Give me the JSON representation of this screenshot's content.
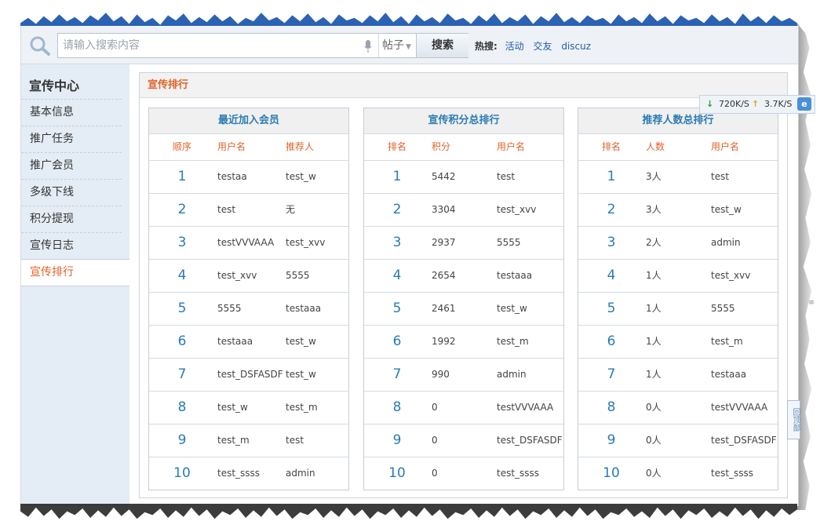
{
  "search": {
    "placeholder": "请输入搜索内容",
    "type_selected": "帖子",
    "button_label": "搜索",
    "hot_label": "热搜:",
    "hot_links": [
      "活动",
      "交友",
      "discuz"
    ]
  },
  "sidebar": {
    "title": "宣传中心",
    "items": [
      {
        "label": "基本信息",
        "active": false
      },
      {
        "label": "推广任务",
        "active": false
      },
      {
        "label": "推广会员",
        "active": false
      },
      {
        "label": "多级下线",
        "active": false
      },
      {
        "label": "积分提现",
        "active": false
      },
      {
        "label": "宣传日志",
        "active": false
      },
      {
        "label": "宣传排行",
        "active": true
      }
    ]
  },
  "panel": {
    "title": "宣传排行"
  },
  "tables": [
    {
      "title": "最近加入会员",
      "columns": [
        "顺序",
        "用户名",
        "推荐人"
      ],
      "rows": [
        [
          "1",
          "testaa",
          "test_w"
        ],
        [
          "2",
          "test",
          "无"
        ],
        [
          "3",
          "testVVVAAA",
          "test_xvv"
        ],
        [
          "4",
          "test_xvv",
          "5555"
        ],
        [
          "5",
          "5555",
          "testaaa"
        ],
        [
          "6",
          "testaaa",
          "test_w"
        ],
        [
          "7",
          "test_DSFASDF",
          "test_w"
        ],
        [
          "8",
          "test_w",
          "test_m"
        ],
        [
          "9",
          "test_m",
          "test"
        ],
        [
          "10",
          "test_ssss",
          "admin"
        ]
      ]
    },
    {
      "title": "宣传积分总排行",
      "columns": [
        "排名",
        "积分",
        "用户名"
      ],
      "rows": [
        [
          "1",
          "5442",
          "test"
        ],
        [
          "2",
          "3304",
          "test_xvv"
        ],
        [
          "3",
          "2937",
          "5555"
        ],
        [
          "4",
          "2654",
          "testaaa"
        ],
        [
          "5",
          "2461",
          "test_w"
        ],
        [
          "6",
          "1992",
          "test_m"
        ],
        [
          "7",
          "990",
          "admin"
        ],
        [
          "8",
          "0",
          "testVVVAAA"
        ],
        [
          "9",
          "0",
          "test_DSFASDF"
        ],
        [
          "10",
          "0",
          "test_ssss"
        ]
      ]
    },
    {
      "title": "推荐人数总排行",
      "columns": [
        "排名",
        "人数",
        "用户名"
      ],
      "rows": [
        [
          "1",
          "3人",
          "test"
        ],
        [
          "2",
          "3人",
          "test_w"
        ],
        [
          "3",
          "2人",
          "admin"
        ],
        [
          "4",
          "1人",
          "test_xvv"
        ],
        [
          "5",
          "1人",
          "5555"
        ],
        [
          "6",
          "1人",
          "test_m"
        ],
        [
          "7",
          "1人",
          "testaaa"
        ],
        [
          "8",
          "0人",
          "testVVVAAA"
        ],
        [
          "9",
          "0人",
          "test_DSFASDF"
        ],
        [
          "10",
          "0人",
          "test_ssss"
        ]
      ]
    }
  ],
  "speed_widget": {
    "download": "720K/S",
    "upload": "3.7K/S"
  },
  "back_to_top_label": "回顶部",
  "colors": {
    "accent_orange": "#e0642a",
    "link_blue": "#2a7bb5",
    "sidebar_bg": "#e4ecf5"
  }
}
